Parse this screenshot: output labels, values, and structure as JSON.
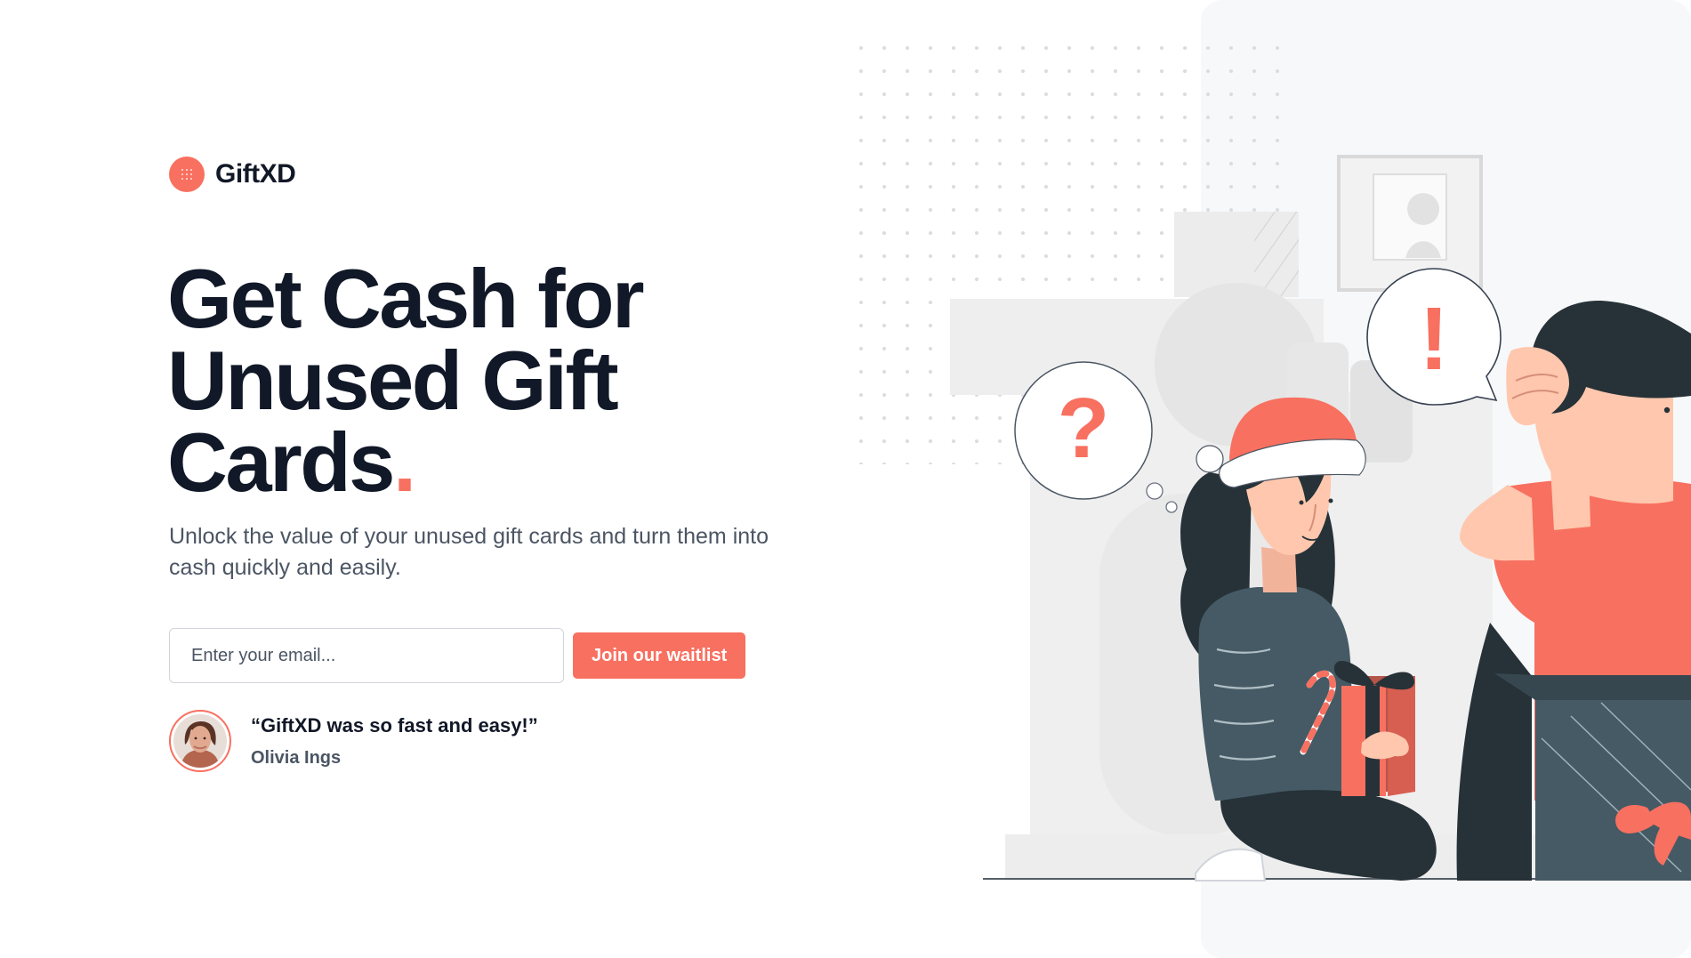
{
  "brand": {
    "name": "GiftXD",
    "accent_color": "#f87060",
    "icon": "grid-dots-icon"
  },
  "hero": {
    "headline_line1": "Get Cash for",
    "headline_line2": "Unused Gift",
    "headline_line3": "Cards",
    "headline_dot": ".",
    "subcopy": "Unlock the value of your unused gift cards and turn them into cash quickly and easily."
  },
  "waitlist": {
    "email_placeholder": "Enter your email...",
    "email_value": "",
    "button_label": "Join our waitlist"
  },
  "testimonial": {
    "quote": "“GiftXD was so fast and easy!”",
    "author": "Olivia Ings"
  },
  "illustration": {
    "question_mark": "?",
    "exclamation_mark": "!"
  },
  "colors": {
    "text_primary": "#111827",
    "text_secondary": "#4b5563",
    "illustration_panel": "#f7f8fa"
  }
}
